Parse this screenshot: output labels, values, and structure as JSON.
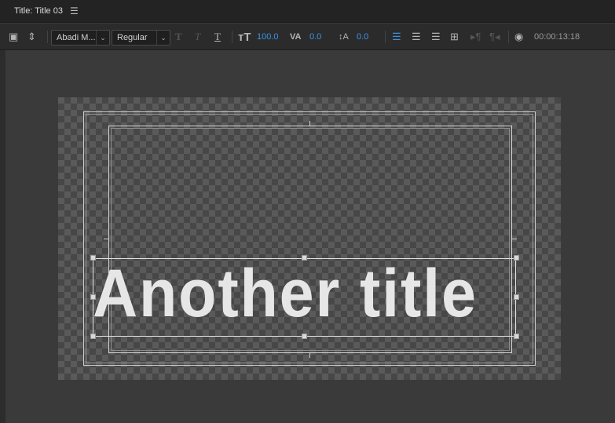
{
  "panel": {
    "title": "Title: Title 03",
    "menu_icon": "hamburger-menu-icon"
  },
  "toolbar": {
    "font_family": "Abadi M...",
    "font_style": "Regular",
    "font_size": "100.0",
    "kerning": "0.0",
    "leading": "0.0",
    "timecode": "00:00:13:18",
    "accent_color": "#3b94e6"
  },
  "canvas": {
    "title_text": "Another title"
  }
}
